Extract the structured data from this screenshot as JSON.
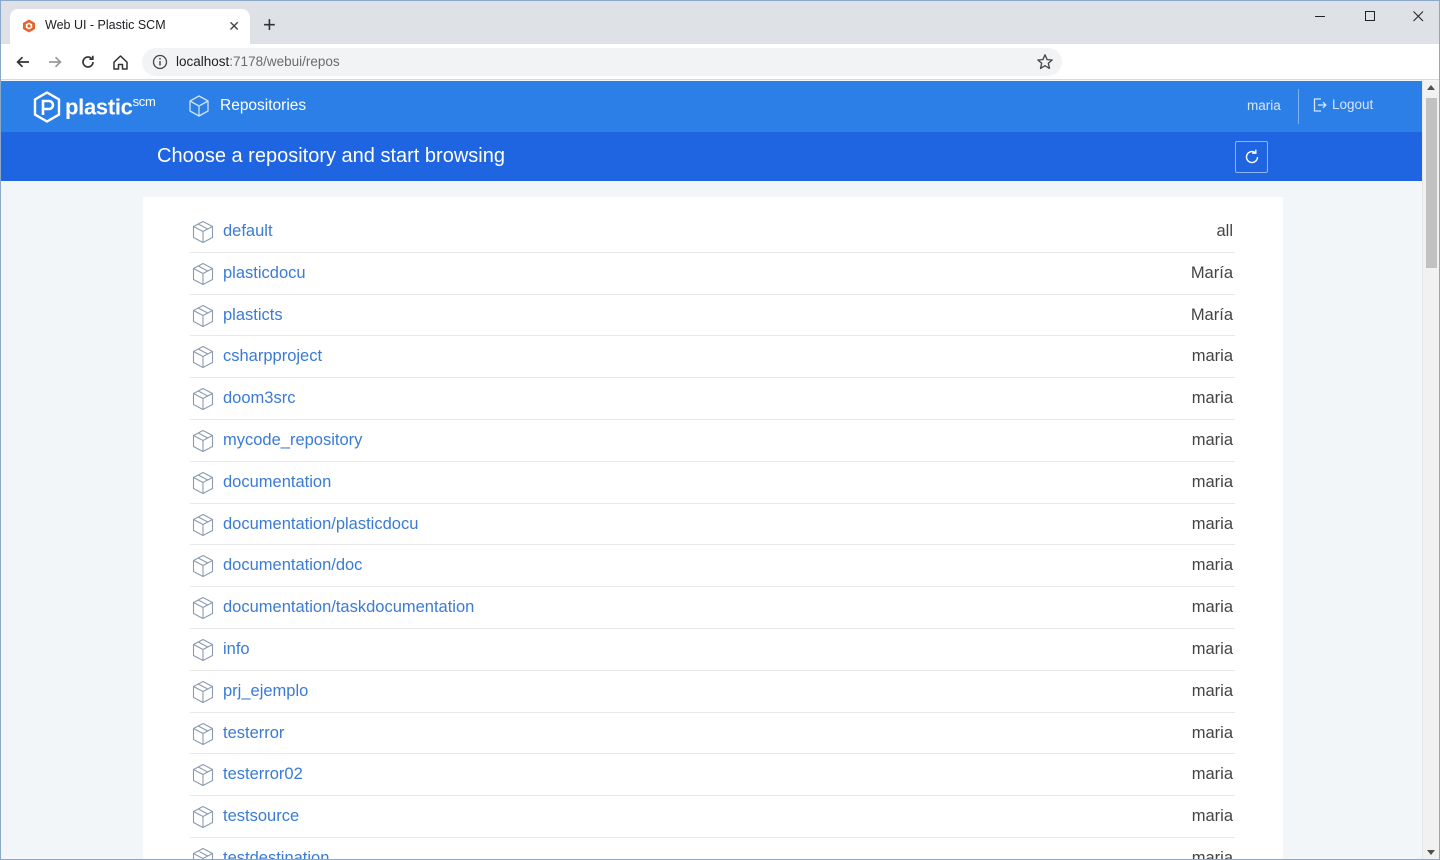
{
  "browser": {
    "tab_title": "Web UI - Plastic SCM",
    "tab_close": "✕",
    "new_tab": "+",
    "url_host": "localhost",
    "url_rest": ":7178/webui/repos"
  },
  "header": {
    "logo_text": "plastic",
    "logo_suffix": "scm",
    "nav_repositories": "Repositories",
    "user": "maria",
    "logout": "Logout"
  },
  "subheader": {
    "title": "Choose a repository and start browsing"
  },
  "repos": [
    {
      "name": "default",
      "owner": "all"
    },
    {
      "name": "plasticdocu",
      "owner": "María"
    },
    {
      "name": "plasticts",
      "owner": "María"
    },
    {
      "name": "csharpproject",
      "owner": "maria"
    },
    {
      "name": "doom3src",
      "owner": "maria"
    },
    {
      "name": "mycode_repository",
      "owner": "maria"
    },
    {
      "name": "documentation",
      "owner": "maria"
    },
    {
      "name": "documentation/plasticdocu",
      "owner": "maria"
    },
    {
      "name": "documentation/doc",
      "owner": "maria"
    },
    {
      "name": "documentation/taskdocumentation",
      "owner": "maria"
    },
    {
      "name": "info",
      "owner": "maria"
    },
    {
      "name": "prj_ejemplo",
      "owner": "maria"
    },
    {
      "name": "testerror",
      "owner": "maria"
    },
    {
      "name": "testerror02",
      "owner": "maria"
    },
    {
      "name": "testsource",
      "owner": "maria"
    },
    {
      "name": "testdestination",
      "owner": "maria"
    }
  ],
  "colors": {
    "header": "#2b7fe6",
    "subheader": "#1f64e0",
    "link": "#3a7bd5"
  }
}
